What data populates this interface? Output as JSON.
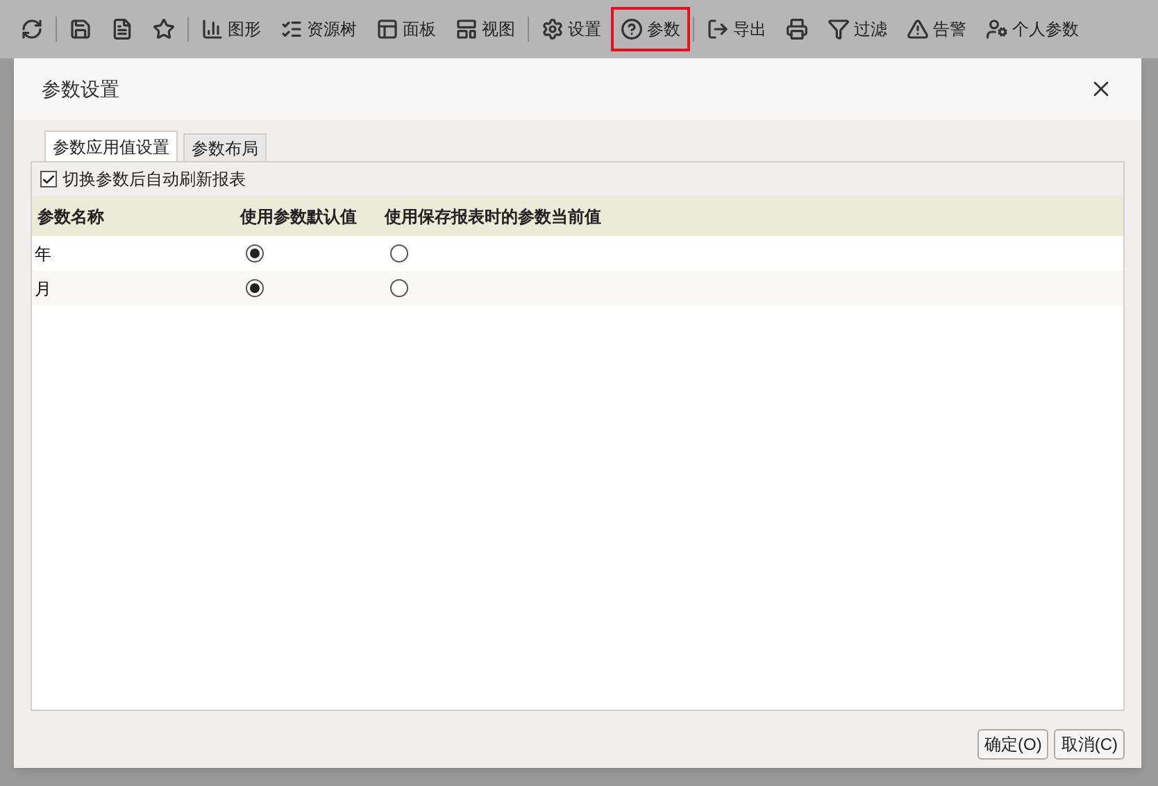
{
  "toolbar": {
    "groups": [
      [
        {
          "highlighted": false
        }
      ],
      [
        {
          "highlighted": false
        },
        {
          "highlighted": false
        },
        {
          "highlighted": false
        }
      ],
      [
        {
          "label": "图形",
          "highlighted": false
        },
        {
          "label": "资源树",
          "highlighted": false
        },
        {
          "label": "面板",
          "highlighted": false
        },
        {
          "label": "视图",
          "highlighted": false
        }
      ],
      [
        {
          "label": "设置",
          "highlighted": false
        },
        {
          "label": "参数",
          "highlighted": true
        }
      ],
      [
        {
          "label": "导出",
          "highlighted": false
        },
        {
          "highlighted": false
        },
        {
          "label": "过滤",
          "highlighted": false
        },
        {
          "label": "告警",
          "highlighted": false
        },
        {
          "label": "个人参数",
          "highlighted": false
        }
      ]
    ]
  },
  "dialog": {
    "title": "参数设置",
    "tabs": [
      {
        "label": "参数应用值设置",
        "selected": true
      },
      {
        "label": "参数布局",
        "selected": false
      }
    ],
    "auto_refresh": {
      "label": "切换参数后自动刷新报表",
      "checked": true
    },
    "table": {
      "columns": [
        "参数名称",
        "使用参数默认值",
        "使用保存报表时的参数当前值"
      ],
      "rows": [
        {
          "name": "年",
          "options": [
            {
              "selected": true
            },
            {
              "selected": false
            }
          ]
        },
        {
          "name": "月",
          "options": [
            {
              "selected": true
            },
            {
              "selected": false
            }
          ]
        }
      ]
    },
    "buttons": [
      "确定(O)",
      "取消(C)"
    ]
  }
}
